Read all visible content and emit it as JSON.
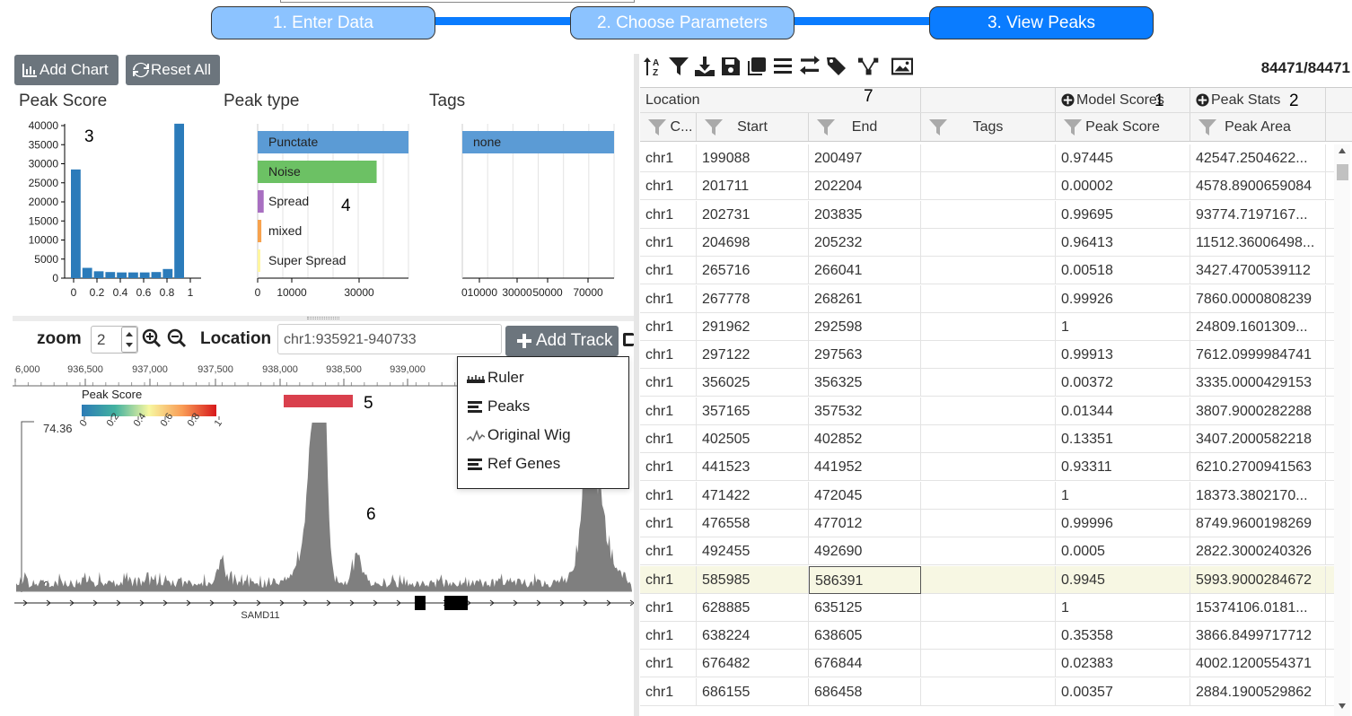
{
  "stepper": {
    "steps": [
      {
        "label": "1. Enter Data",
        "state": "done"
      },
      {
        "label": "2. Choose Parameters",
        "state": "done"
      },
      {
        "label": "3. View Peaks",
        "state": "active"
      }
    ],
    "colors": {
      "done": "#8cc3ff",
      "active": "#0a7cff"
    }
  },
  "left_toolbar": {
    "add_chart_label": "Add Chart",
    "reset_all_label": "Reset All"
  },
  "panel_numbers": {
    "n1": "1",
    "n2": "2",
    "n3": "3",
    "n4": "4",
    "n5": "5",
    "n6": "6",
    "n7": "7"
  },
  "charts": {
    "peak_score_title": "Peak Score",
    "peak_type_title": "Peak type",
    "tags_title": "Tags"
  },
  "chart_data": [
    {
      "type": "bar",
      "title": "Peak Score",
      "x": [
        0,
        0.1,
        0.2,
        0.3,
        0.4,
        0.5,
        0.6,
        0.7,
        0.8,
        0.9
      ],
      "values": [
        28500,
        2700,
        1800,
        1600,
        1500,
        1500,
        1500,
        1600,
        2400,
        40500
      ],
      "ylim": [
        0,
        40000
      ],
      "yticks": [
        "0",
        "5000",
        "10000",
        "15000",
        "20000",
        "25000",
        "30000",
        "35000",
        "40000"
      ],
      "xticks": [
        "0",
        "0.2",
        "0.4",
        "0.6",
        "0.8",
        "1"
      ],
      "color": "#2b7bba"
    },
    {
      "type": "bar",
      "orientation": "horizontal",
      "title": "Peak type",
      "categories": [
        "Punctate",
        "Noise",
        "Spread",
        "mixed",
        "Super Spread"
      ],
      "values": [
        45000,
        35500,
        1800,
        1100,
        200
      ],
      "colors": [
        "#5b9bd5",
        "#6cc164",
        "#a86fc1",
        "#f7a24d",
        "#fff6a0"
      ],
      "xlim": [
        0,
        45000
      ],
      "xticks": [
        "0",
        "10000",
        "30000"
      ]
    },
    {
      "type": "bar",
      "orientation": "horizontal",
      "title": "Tags",
      "categories": [
        "none"
      ],
      "values": [
        84471
      ],
      "colors": [
        "#5b9bd5"
      ],
      "xlim": [
        0,
        84471
      ],
      "xticks": [
        "010000",
        "30000",
        "50000",
        "70000"
      ]
    }
  ],
  "browser": {
    "zoom_label": "zoom",
    "zoom_value": "2",
    "location_label": "Location",
    "location_value": "chr1:935921-940733",
    "add_track_label": "Add Track",
    "ruler_ticks": [
      "6,000",
      "936,500",
      "937,000",
      "937,500",
      "938,000",
      "938,500",
      "939,000",
      "9"
    ],
    "legend_title": "Peak Score",
    "legend_ticks": [
      "0",
      "0.2",
      "0.4",
      "0.6",
      "0.8",
      "1"
    ],
    "wig_max": "74.36",
    "wig_min": "0",
    "gene_name": "SAMD11",
    "track_menu": [
      "Ruler",
      "Peaks",
      "Original Wig",
      "Ref Genes"
    ]
  },
  "grid": {
    "count": "84471/84471",
    "group_headers": {
      "location": "Location",
      "model_scores": "Model Scores",
      "peak_stats": "Peak Stats"
    },
    "columns": [
      "C...",
      "Start",
      "End",
      "Tags",
      "Peak Score",
      "Peak Area"
    ],
    "rows": [
      [
        "chr1",
        "199088",
        "200497",
        "",
        "0.97445",
        "42547.2504622..."
      ],
      [
        "chr1",
        "201711",
        "202204",
        "",
        "0.00002",
        "4578.8900659084"
      ],
      [
        "chr1",
        "202731",
        "203835",
        "",
        "0.99695",
        "93774.7197167..."
      ],
      [
        "chr1",
        "204698",
        "205232",
        "",
        "0.96413",
        "11512.36006498..."
      ],
      [
        "chr1",
        "265716",
        "266041",
        "",
        "0.00518",
        "3427.4700539112"
      ],
      [
        "chr1",
        "267778",
        "268261",
        "",
        "0.99926",
        "7860.0000808239"
      ],
      [
        "chr1",
        "291962",
        "292598",
        "",
        "1",
        "24809.1601309..."
      ],
      [
        "chr1",
        "297122",
        "297563",
        "",
        "0.99913",
        "7612.0999984741"
      ],
      [
        "chr1",
        "356025",
        "356325",
        "",
        "0.00372",
        "3335.0000429153"
      ],
      [
        "chr1",
        "357165",
        "357532",
        "",
        "0.01344",
        "3807.9000282288"
      ],
      [
        "chr1",
        "402505",
        "402852",
        "",
        "0.13351",
        "3407.2000582218"
      ],
      [
        "chr1",
        "441523",
        "441952",
        "",
        "0.93311",
        "6210.2700941563"
      ],
      [
        "chr1",
        "471422",
        "472045",
        "",
        "1",
        "18373.3802170..."
      ],
      [
        "chr1",
        "476558",
        "477012",
        "",
        "0.99996",
        "8749.9600198269"
      ],
      [
        "chr1",
        "492455",
        "492690",
        "",
        "0.0005",
        "2822.3000240326"
      ],
      [
        "chr1",
        "585985",
        "586391",
        "",
        "0.9945",
        "5993.9000284672"
      ],
      [
        "chr1",
        "628885",
        "635125",
        "",
        "1",
        "15374106.0181..."
      ],
      [
        "chr1",
        "638224",
        "638605",
        "",
        "0.35358",
        "3866.8499717712"
      ],
      [
        "chr1",
        "676482",
        "676844",
        "",
        "0.02383",
        "4002.1200554371"
      ],
      [
        "chr1",
        "686155",
        "686458",
        "",
        "0.00357",
        "2884.1900529862"
      ]
    ],
    "selected_row": 15
  }
}
